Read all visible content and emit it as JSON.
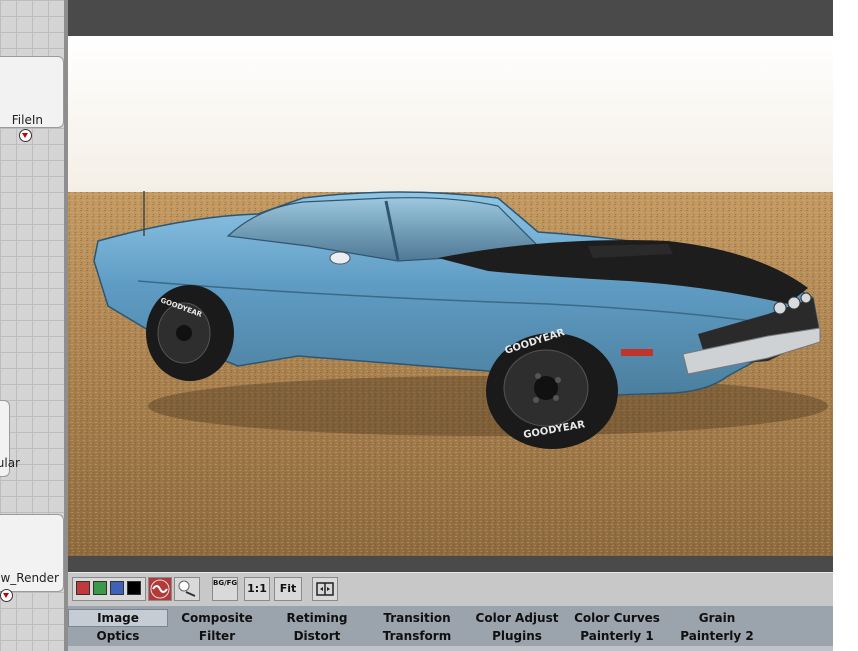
{
  "node_graph": {
    "nodes": [
      {
        "label": "FileIn"
      },
      {
        "label": "ular"
      },
      {
        "label": "w_Render"
      }
    ]
  },
  "toolbar": {
    "colors": {
      "red": "#c0393b",
      "green": "#3a9a4a",
      "blue": "#3e62b8",
      "black": "#000000",
      "accent": "#b43a3a"
    },
    "bg_fg_label": "BG/FG",
    "one_to_one_label": "1:1",
    "fit_label": "Fit"
  },
  "tabs": {
    "row1": [
      "Image",
      "Composite",
      "Retiming",
      "Transition",
      "Color Adjust",
      "Color Curves",
      "Grain"
    ],
    "row2": [
      "Optics",
      "Filter",
      "Distort",
      "Transform",
      "Plugins",
      "Painterly 1",
      "Painterly 2"
    ],
    "active": "Image"
  },
  "viewer": {
    "tire_text": "GOODYEAR"
  }
}
